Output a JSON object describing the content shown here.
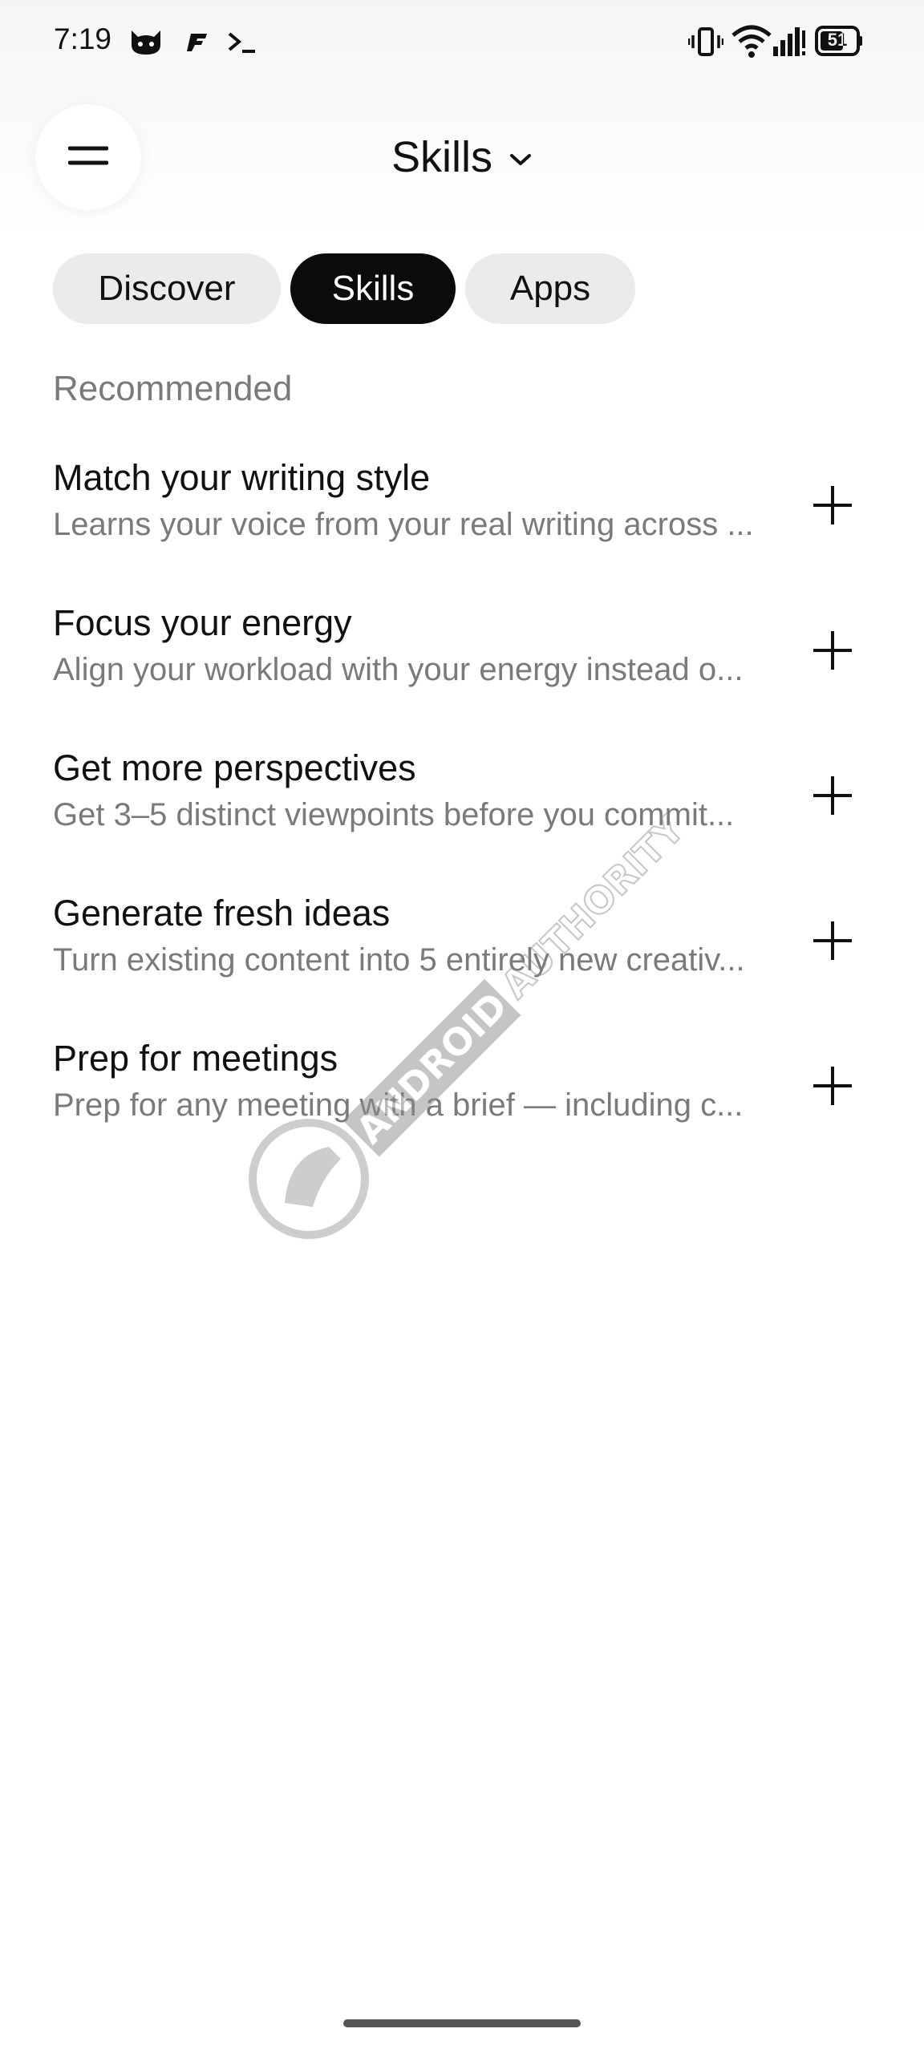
{
  "status_bar": {
    "time": "7:19",
    "app_icons": [
      "cat-app-icon",
      "flash-app-icon",
      "terminal-icon"
    ],
    "system_icons": [
      "vibrate-icon",
      "wifi-icon",
      "signal-icon"
    ],
    "battery_level": "51"
  },
  "header": {
    "title": "Skills",
    "menu_icon": "hamburger-menu-icon",
    "dropdown_icon": "chevron-down-icon"
  },
  "tabs": [
    {
      "label": "Discover",
      "active": false
    },
    {
      "label": "Skills",
      "active": true
    },
    {
      "label": "Apps",
      "active": false
    }
  ],
  "section": {
    "heading": "Recommended"
  },
  "skills": [
    {
      "title": "Match your writing style",
      "description": "Learns your voice from your real writing across ..."
    },
    {
      "title": "Focus your energy",
      "description": "Align your workload with your energy instead o..."
    },
    {
      "title": "Get more perspectives",
      "description": "Get 3–5 distinct viewpoints before you commit..."
    },
    {
      "title": "Generate fresh ideas",
      "description": "Turn existing content into 5 entirely new creativ..."
    },
    {
      "title": "Prep for meetings",
      "description": "Prep for any meeting with a brief — including c..."
    }
  ],
  "watermark": {
    "text": "ANDROID AUTHORITY"
  },
  "colors": {
    "active_tab_bg": "#0b0b0b",
    "inactive_tab_bg": "#ebebeb",
    "secondary_text": "#7a7a7a",
    "primary_text": "#111111"
  }
}
